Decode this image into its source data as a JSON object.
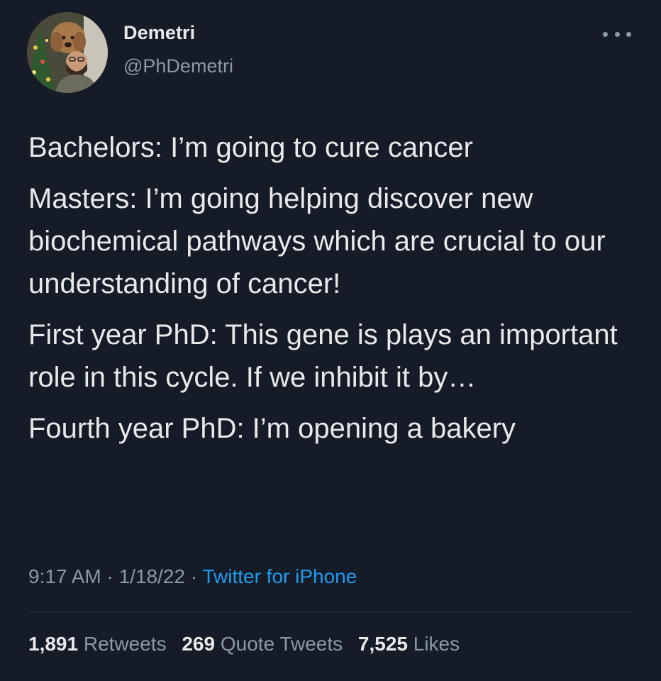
{
  "author": {
    "display_name": "Demetri",
    "handle": "@PhDemetri"
  },
  "icons": {
    "more": "more-horizontal-icon",
    "avatar": "profile-photo"
  },
  "tweet": {
    "paragraphs": [
      "Bachelors: I’m going to cure cancer",
      "Masters: I’m going helping discover new biochemical pathways which are crucial to our understanding of cancer!",
      "First year PhD: This gene is plays an important role in this cycle. If we inhibit it by…",
      "Fourth year PhD: I’m opening a bakery"
    ]
  },
  "meta": {
    "time": "9:17 AM",
    "date": "1/18/22",
    "separator": " · ",
    "source": "Twitter for iPhone"
  },
  "stats": {
    "retweets": {
      "count": "1,891",
      "label": "Retweets"
    },
    "quotes": {
      "count": "269",
      "label": "Quote Tweets"
    },
    "likes": {
      "count": "7,525",
      "label": "Likes"
    }
  },
  "colors": {
    "background": "#151c27",
    "text": "#e7e9ea",
    "secondary": "#8b98a5",
    "link": "#1d9bf0"
  }
}
